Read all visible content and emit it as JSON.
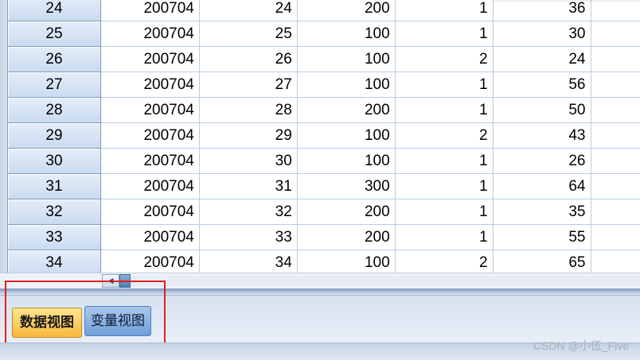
{
  "grid": {
    "rows": [
      {
        "row": "24",
        "cells": [
          "200704",
          "24",
          "200",
          "1",
          "36"
        ]
      },
      {
        "row": "25",
        "cells": [
          "200704",
          "25",
          "100",
          "1",
          "30"
        ]
      },
      {
        "row": "26",
        "cells": [
          "200704",
          "26",
          "100",
          "2",
          "24"
        ]
      },
      {
        "row": "27",
        "cells": [
          "200704",
          "27",
          "100",
          "1",
          "56"
        ]
      },
      {
        "row": "28",
        "cells": [
          "200704",
          "28",
          "200",
          "1",
          "50"
        ]
      },
      {
        "row": "29",
        "cells": [
          "200704",
          "29",
          "100",
          "2",
          "43"
        ]
      },
      {
        "row": "30",
        "cells": [
          "200704",
          "30",
          "100",
          "1",
          "26"
        ]
      },
      {
        "row": "31",
        "cells": [
          "200704",
          "31",
          "300",
          "1",
          "64"
        ]
      },
      {
        "row": "32",
        "cells": [
          "200704",
          "32",
          "200",
          "1",
          "35"
        ]
      },
      {
        "row": "33",
        "cells": [
          "200704",
          "33",
          "200",
          "1",
          "55"
        ]
      },
      {
        "row": "34",
        "cells": [
          "200704",
          "34",
          "100",
          "2",
          "65"
        ]
      }
    ]
  },
  "tabs": {
    "data_view": "数据视图",
    "variable_view": "变量视图",
    "active": "data_view"
  },
  "scrollbar": {
    "left_arrow_icon": "triangle-left-icon"
  },
  "watermark": "CSDN @小伍_Five",
  "colors": {
    "active_tab": "#f6b93d",
    "inactive_tab": "#6f9fd8",
    "highlight": "#e02020",
    "grid_line": "#b9cce3"
  }
}
